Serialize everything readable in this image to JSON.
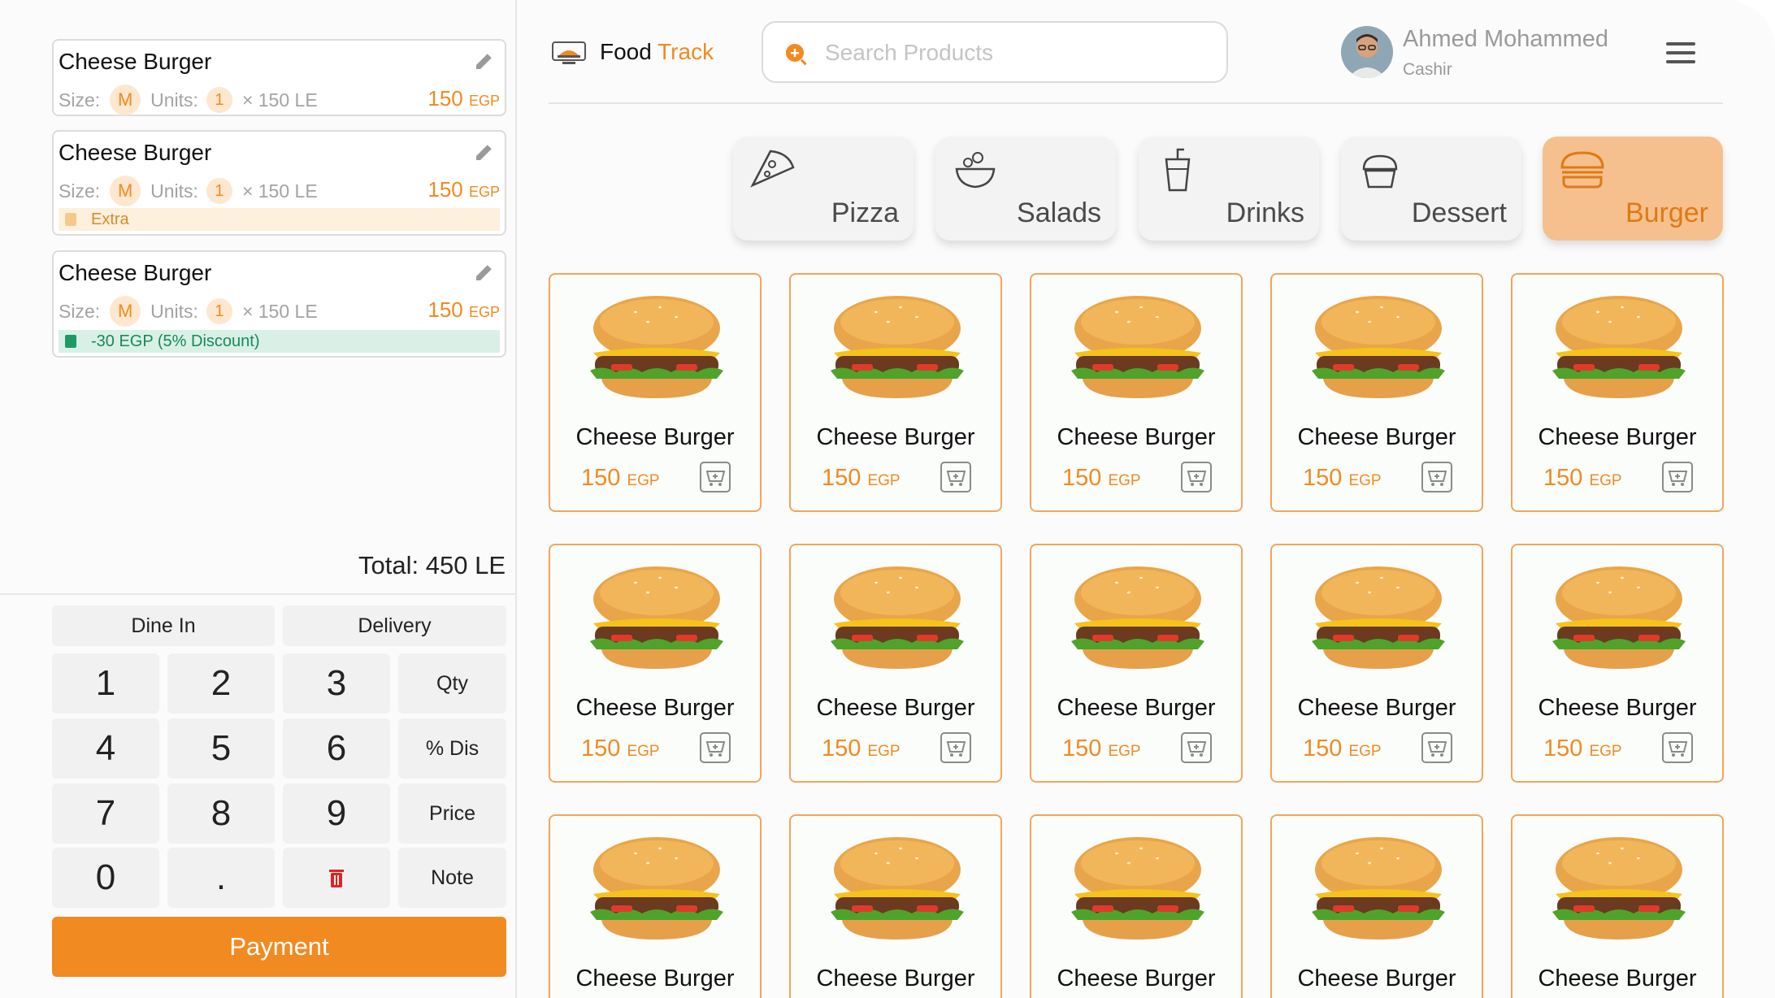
{
  "header": {
    "brand_a": "Food",
    "brand_b": "Track",
    "search_placeholder": "Search Products",
    "user_name": "Ahmed Mohammed",
    "user_role": "Cashir"
  },
  "order": {
    "items": [
      {
        "name": "Cheese Burger",
        "size_label": "Size:",
        "size": "M",
        "units_label": "Units:",
        "units": "1",
        "unit_price": "× 150 LE",
        "price": "150",
        "currency": "EGP",
        "tag": ""
      },
      {
        "name": "Cheese Burger",
        "size_label": "Size:",
        "size": "M",
        "units_label": "Units:",
        "units": "1",
        "unit_price": "× 150 LE",
        "price": "150",
        "currency": "EGP",
        "tag": "Extra"
      },
      {
        "name": "Cheese Burger",
        "size_label": "Size:",
        "size": "M",
        "units_label": "Units:",
        "units": "1",
        "unit_price": "× 150 LE",
        "price": "150",
        "currency": "EGP",
        "tag": "-30 EGP (5% Discount)"
      }
    ],
    "total": "Total: 450 LE"
  },
  "keypad": {
    "dine_in": "Dine In",
    "delivery": "Delivery",
    "keys": [
      "1",
      "2",
      "3",
      "4",
      "5",
      "6",
      "7",
      "8",
      "9",
      "0",
      "."
    ],
    "qty": "Qty",
    "dis": "% Dis",
    "price": "Price",
    "note": "Note",
    "payment": "Payment"
  },
  "categories": [
    {
      "label": "Pizza",
      "icon": "pizza-icon",
      "active": false
    },
    {
      "label": "Salads",
      "icon": "salad-icon",
      "active": false
    },
    {
      "label": "Drinks",
      "icon": "drink-icon",
      "active": false
    },
    {
      "label": "Dessert",
      "icon": "dessert-icon",
      "active": false
    },
    {
      "label": "Burger",
      "icon": "burger-icon",
      "active": true
    }
  ],
  "products": [
    {
      "name": "Cheese Burger",
      "price": "150",
      "currency": "EGP"
    },
    {
      "name": "Cheese Burger",
      "price": "150",
      "currency": "EGP"
    },
    {
      "name": "Cheese Burger",
      "price": "150",
      "currency": "EGP"
    },
    {
      "name": "Cheese Burger",
      "price": "150",
      "currency": "EGP"
    },
    {
      "name": "Cheese Burger",
      "price": "150",
      "currency": "EGP"
    },
    {
      "name": "Cheese Burger",
      "price": "150",
      "currency": "EGP"
    },
    {
      "name": "Cheese Burger",
      "price": "150",
      "currency": "EGP"
    },
    {
      "name": "Cheese Burger",
      "price": "150",
      "currency": "EGP"
    },
    {
      "name": "Cheese Burger",
      "price": "150",
      "currency": "EGP"
    },
    {
      "name": "Cheese Burger",
      "price": "150",
      "currency": "EGP"
    },
    {
      "name": "Cheese Burger",
      "price": "",
      "currency": ""
    },
    {
      "name": "Cheese Burger",
      "price": "",
      "currency": ""
    },
    {
      "name": "Cheese Burger",
      "price": "",
      "currency": ""
    },
    {
      "name": "Cheese Burger",
      "price": "",
      "currency": ""
    },
    {
      "name": "Cheese Burger",
      "price": "",
      "currency": ""
    }
  ],
  "colors": {
    "accent": "#f18a21",
    "accent_soft": "#f5c08e",
    "card_border": "#f3a55a"
  }
}
